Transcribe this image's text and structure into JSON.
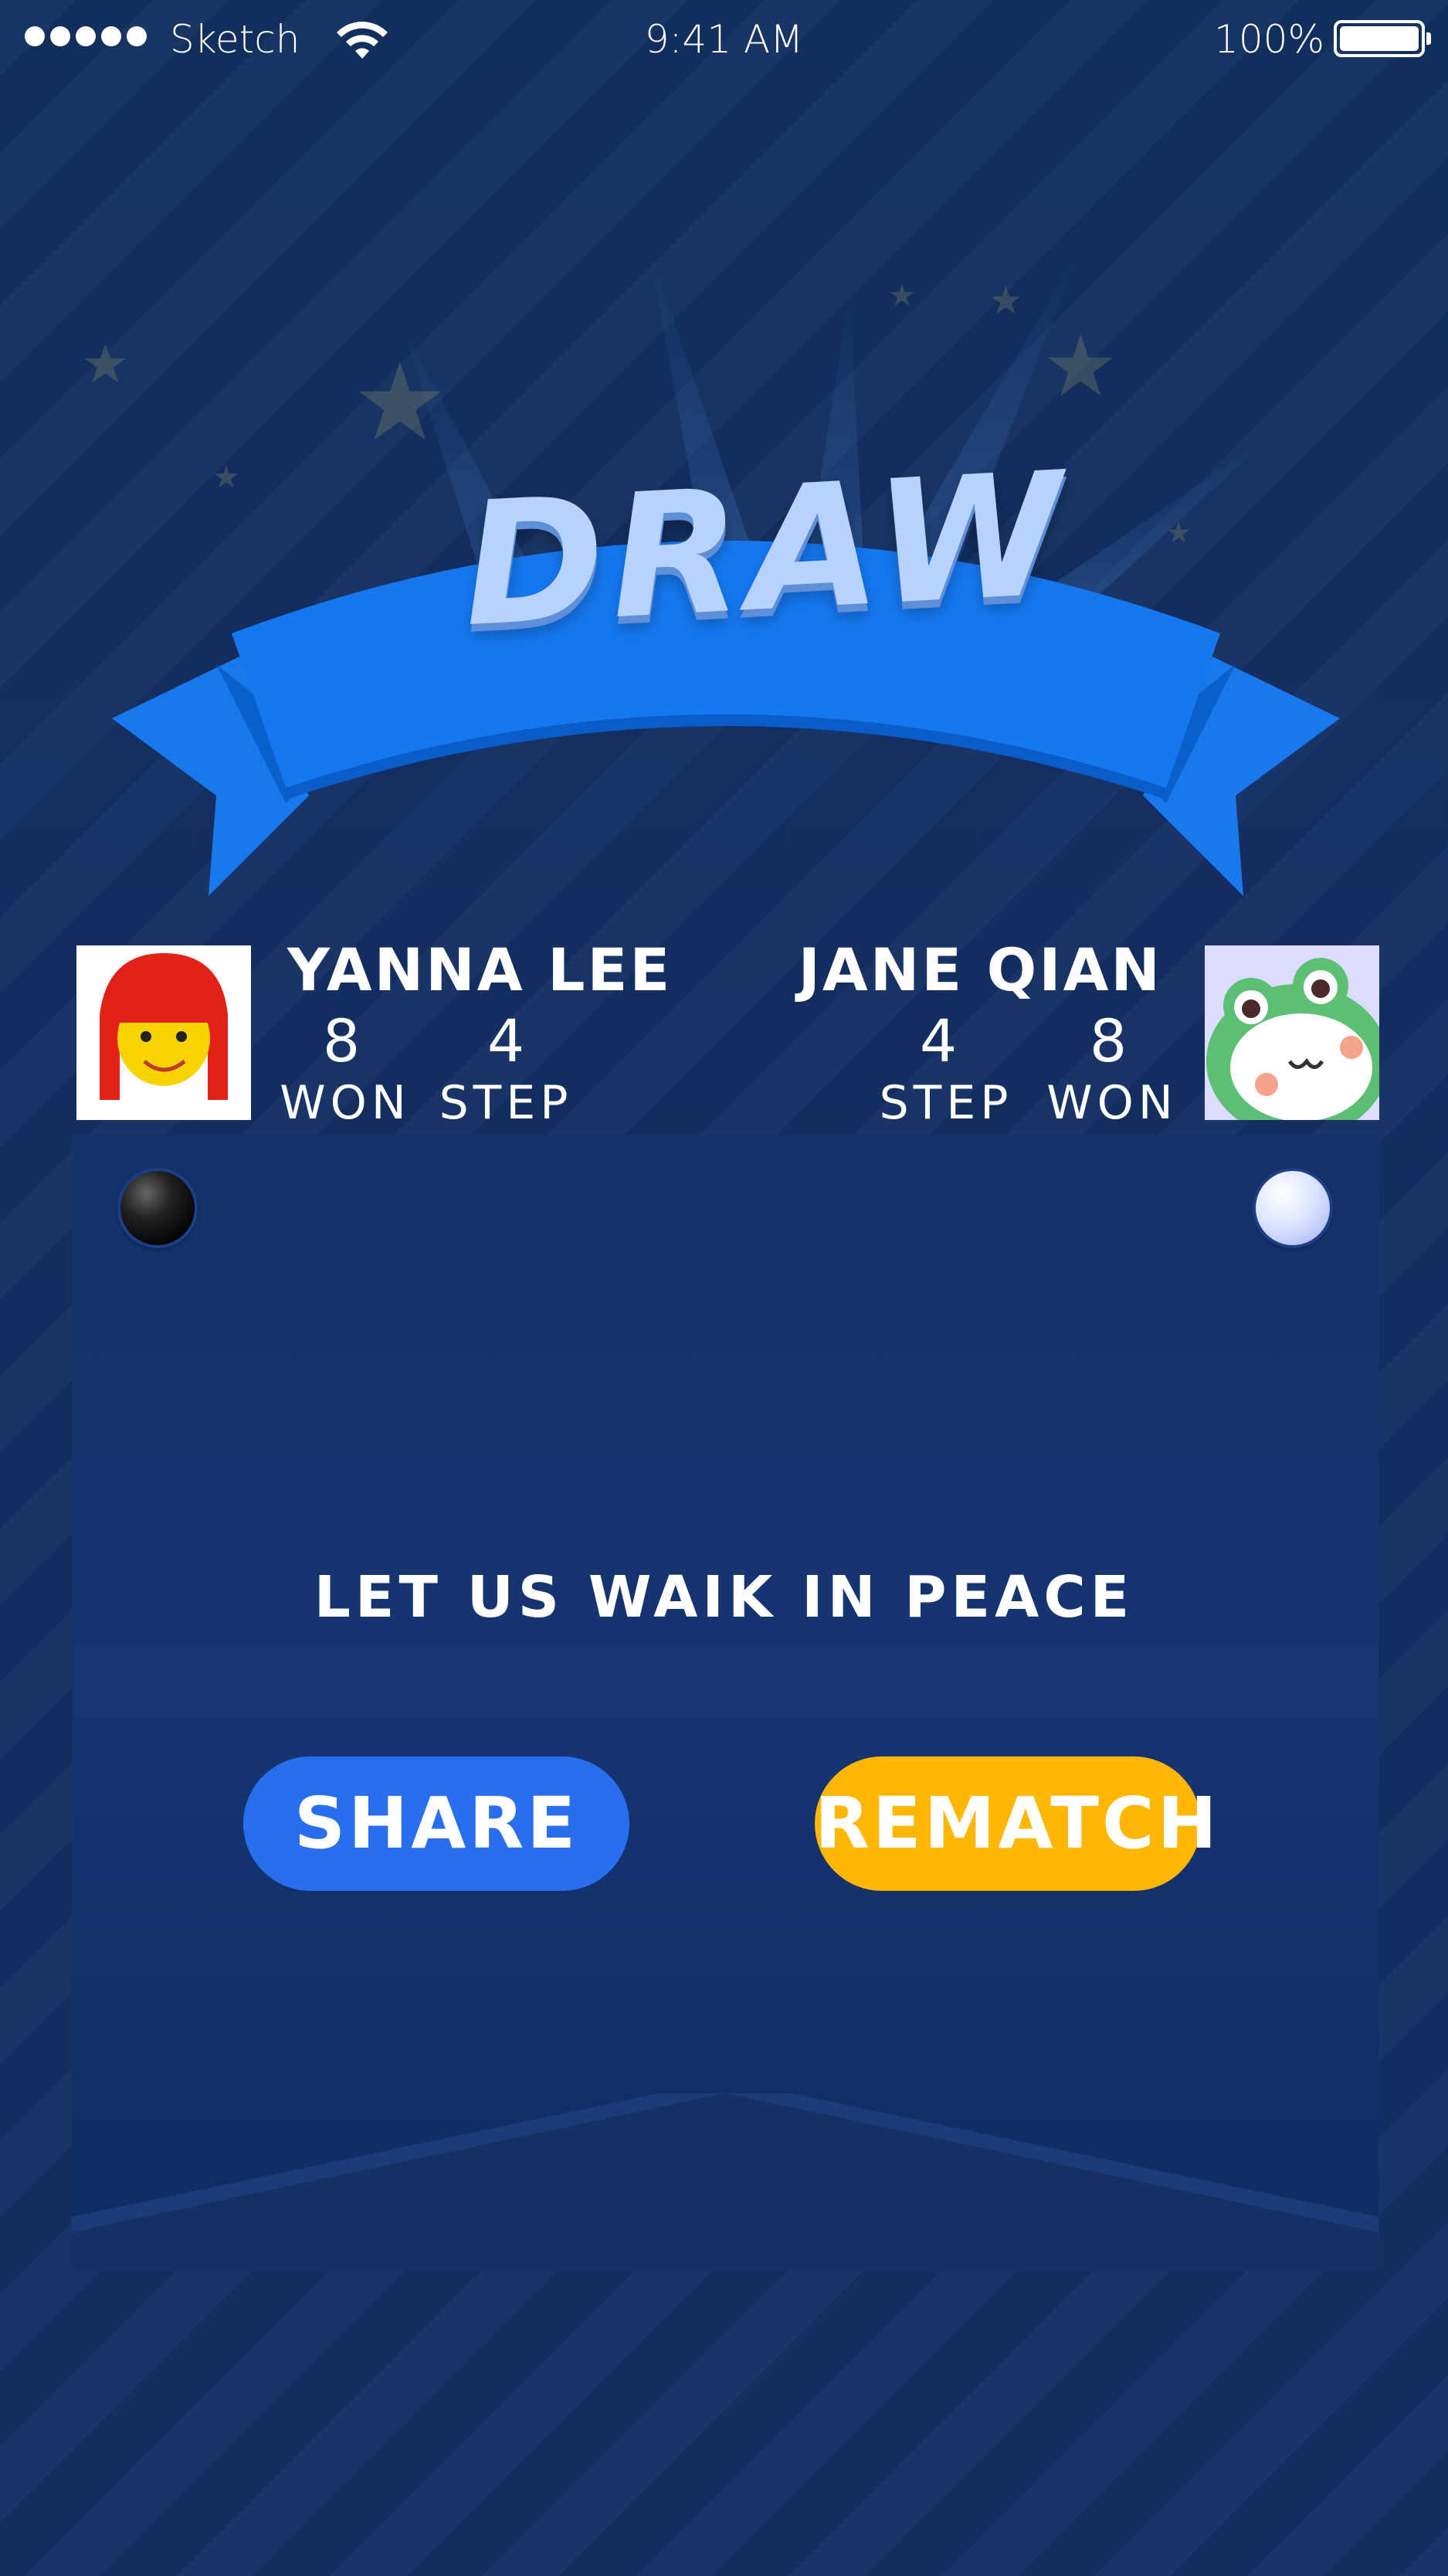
{
  "status_bar": {
    "carrier": "Sketch",
    "time": "9:41 AM",
    "battery": "100%"
  },
  "result": {
    "title": "DRAW"
  },
  "players": [
    {
      "name": "YANNA LEE",
      "won": "8",
      "step": "4",
      "won_label": "WON",
      "step_label": "STEP",
      "stone": "black"
    },
    {
      "name": "JANE QIAN",
      "won": "8",
      "step": "4",
      "won_label": "WON",
      "step_label": "STEP",
      "stone": "white"
    }
  ],
  "message": "LET US WAIK IN PEACE",
  "buttons": {
    "share": "SHARE",
    "rematch": "REMATCH"
  },
  "colors": {
    "background": "#142f63",
    "banner": "#1477ec",
    "title": "#b7d2fb",
    "share": "#2a6ef0",
    "rematch": "#ffb703"
  }
}
